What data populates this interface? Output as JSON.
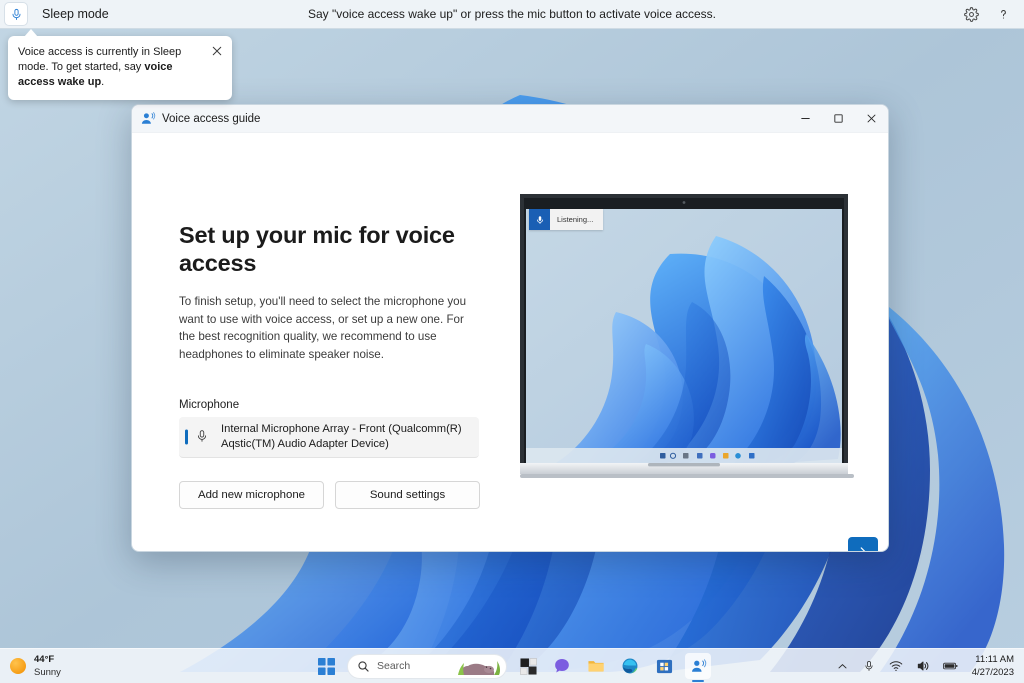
{
  "voice_bar": {
    "state_label": "Sleep mode",
    "hint": "Say \"voice access wake up\" or press the mic button to activate voice access.",
    "mic_icon": "microphone-icon",
    "settings_icon": "gear-icon",
    "help_icon": "help-question-icon"
  },
  "callout": {
    "text_part1": "Voice access is currently in Sleep mode. To get started, say ",
    "text_bold": "voice access wake up",
    "text_part2": ".",
    "close_icon": "close-icon"
  },
  "dialog": {
    "title": "Voice access guide",
    "app_icon": "voice-access-icon",
    "minimize_label": "─",
    "maximize_label": "□",
    "close_label": "✕",
    "heading": "Set up your mic for voice access",
    "paragraph": "To finish setup, you'll need to select the microphone you want to use with voice access, or set up a new one. For the best recognition quality, we recommend to use headphones to eliminate speaker noise.",
    "microphone_label": "Microphone",
    "microphone_selected": "Internal Microphone Array - Front (Qualcomm(R) Aqstic(TM) Audio Adapter Device)",
    "microphone_icon": "microphone-icon",
    "add_mic_button": "Add new microphone",
    "sound_settings_button": "Sound settings",
    "next_button_icon": "chevron-right-icon",
    "accent_color": "#0f6cbd"
  },
  "illustration": {
    "listening_chip_text": "Listening...",
    "listening_chip_icon": "microphone-icon"
  },
  "taskbar": {
    "weather": {
      "temperature": "44°F",
      "condition": "Sunny",
      "icon": "sun-icon"
    },
    "start_icon": "windows-start-icon",
    "search_placeholder": "Search",
    "search_icon": "search-icon",
    "pinned": [
      {
        "name": "widgets-icon",
        "label": "Widgets"
      },
      {
        "name": "chat-icon",
        "label": "Chat"
      },
      {
        "name": "file-explorer-icon",
        "label": "File Explorer"
      },
      {
        "name": "edge-icon",
        "label": "Microsoft Edge"
      },
      {
        "name": "microsoft-store-icon",
        "label": "Microsoft Store"
      },
      {
        "name": "voice-access-icon",
        "label": "Voice access"
      }
    ],
    "tray": {
      "overflow_icon": "chevron-up-icon",
      "mic_icon": "microphone-icon",
      "wifi_icon": "wifi-icon",
      "volume_icon": "speaker-icon",
      "battery_icon": "battery-icon",
      "time": "11:11 AM",
      "date": "4/27/2023"
    }
  }
}
